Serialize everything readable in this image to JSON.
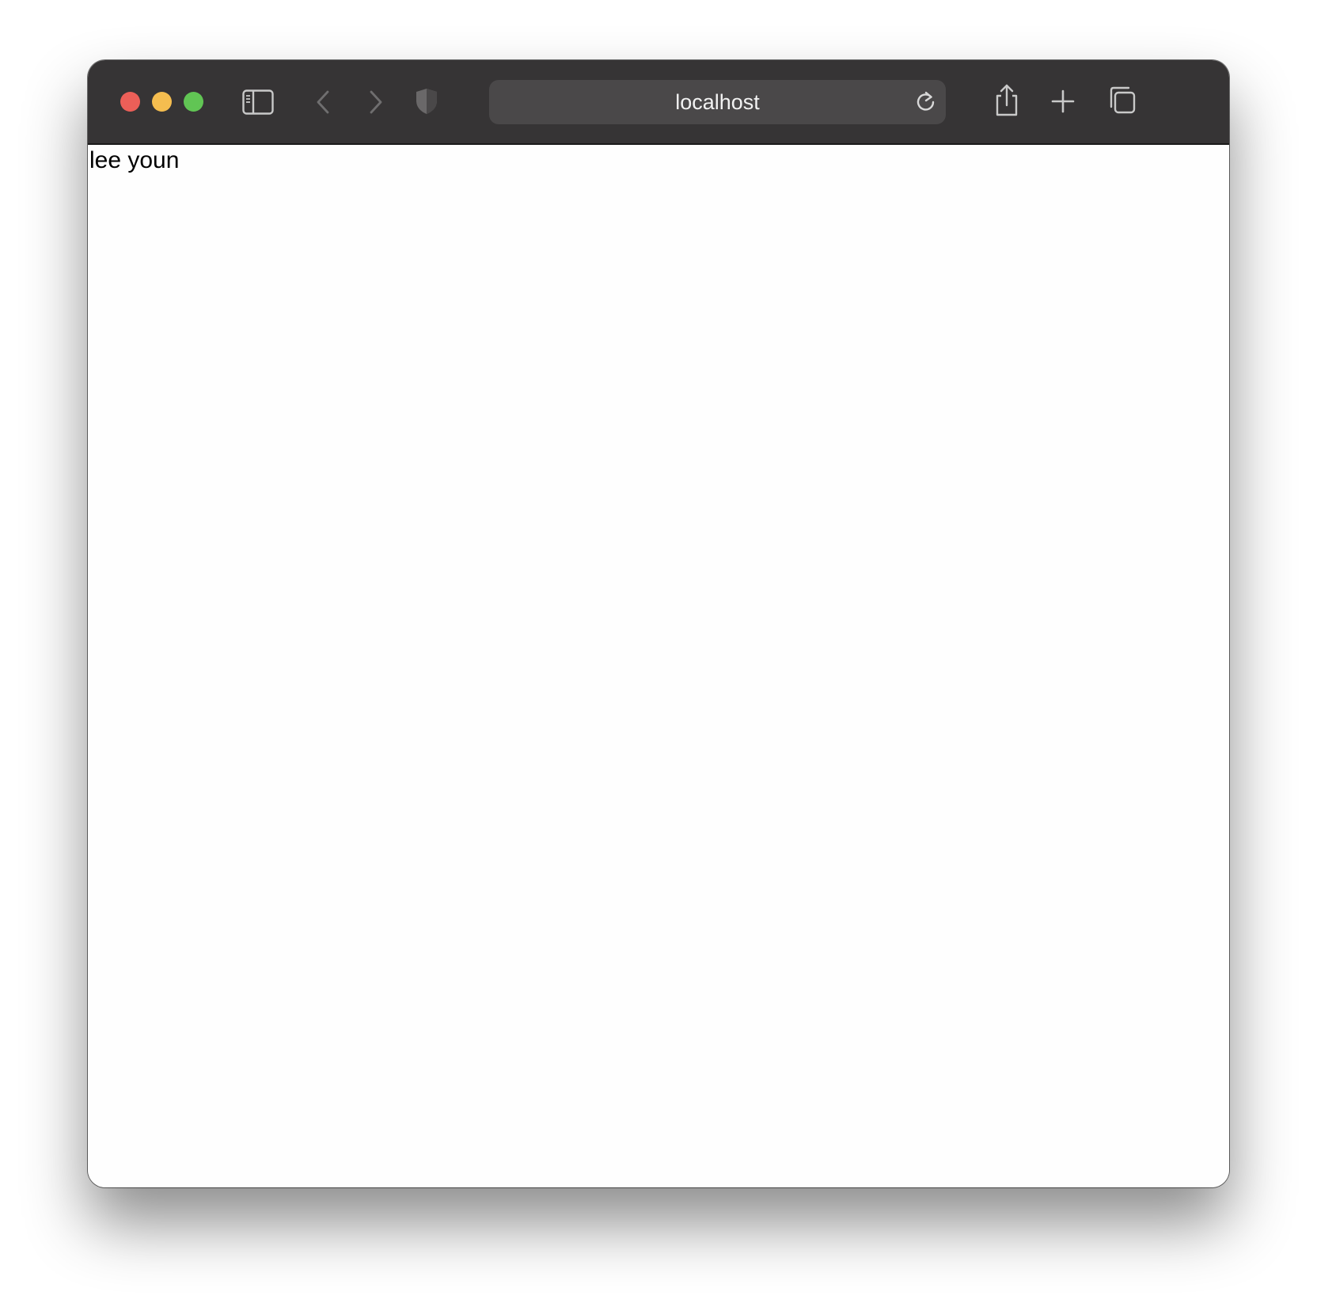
{
  "browser": {
    "address_bar": {
      "url": "localhost"
    },
    "traffic_lights": {
      "close_color": "#ec5f58",
      "minimize_color": "#f5bd4f",
      "maximize_color": "#61c554"
    },
    "toolbar_icons": [
      "sidebar-icon",
      "back-icon",
      "forward-icon",
      "shield-icon",
      "reload-icon",
      "share-icon",
      "new-tab-icon",
      "tabs-overview-icon"
    ]
  },
  "page": {
    "text": "lee youn"
  }
}
